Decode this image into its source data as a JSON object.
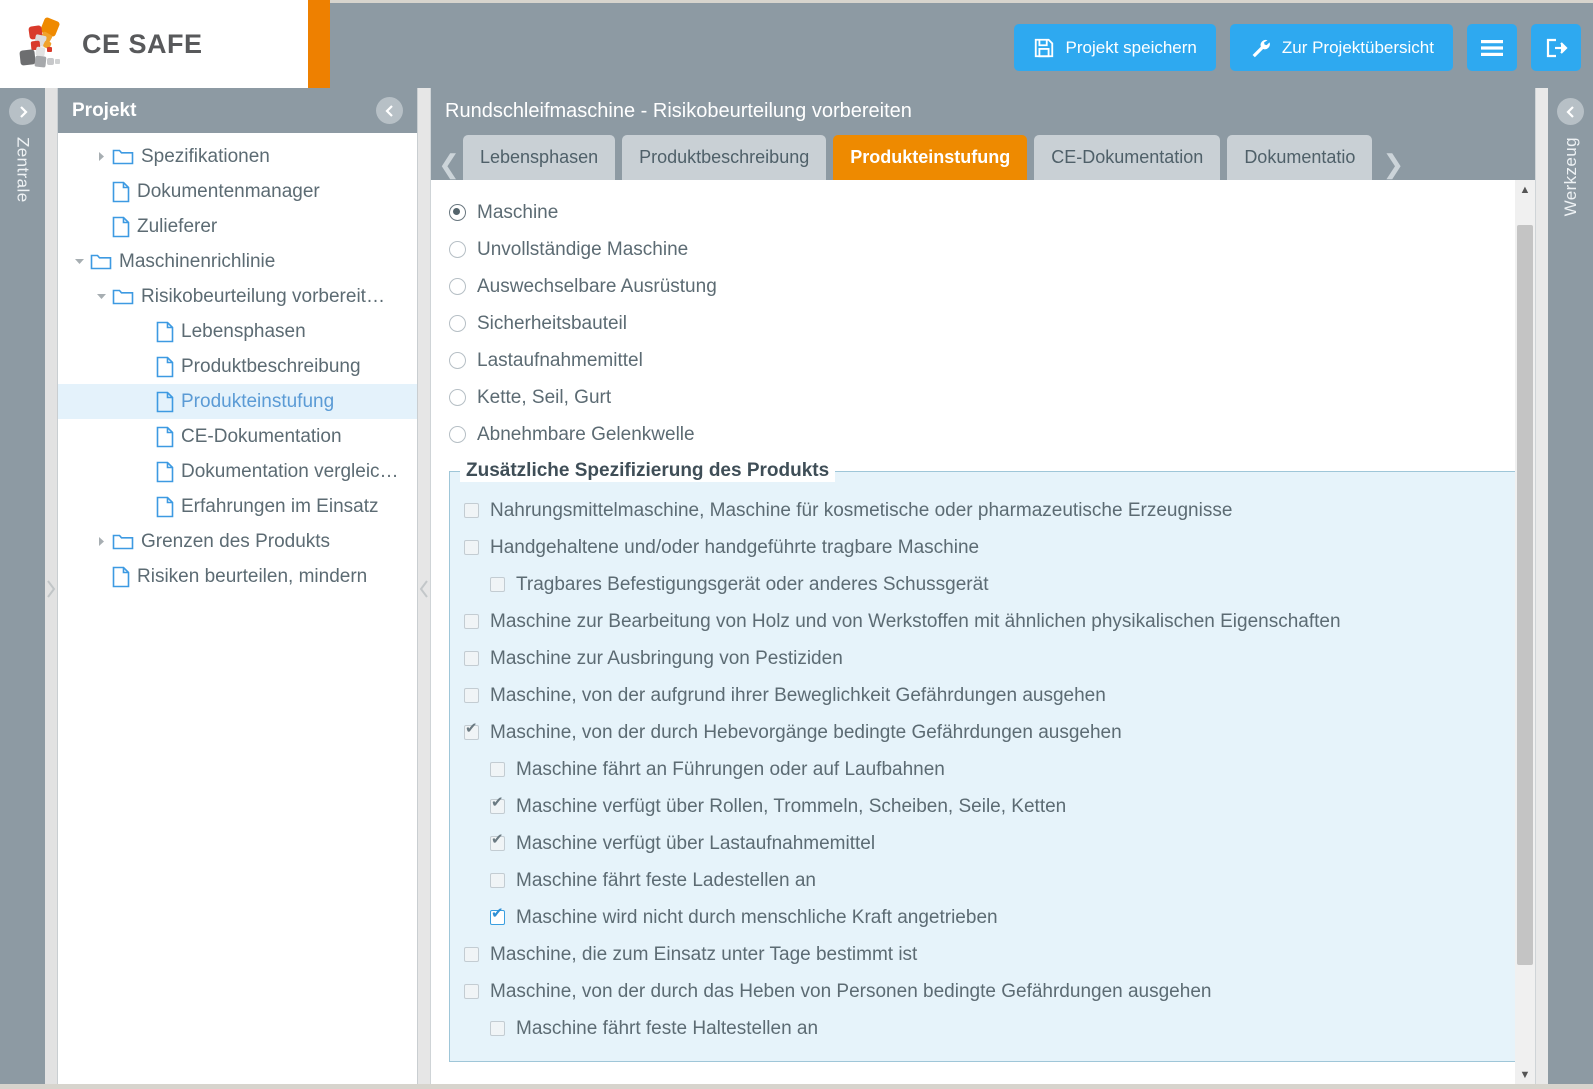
{
  "app": {
    "brand": "CE SAFE",
    "accent_orange": "#ee8000",
    "accent_blue": "#2ea9f0",
    "header_gray": "#8d9aa3"
  },
  "toolbar": {
    "save_label": "Projekt speichern",
    "overview_label": "Zur Projektübersicht",
    "menu_icon": "hamburger-icon",
    "logout_icon": "logout-icon",
    "save_icon": "floppy-disk-icon",
    "overview_icon": "wrench-icon"
  },
  "rails": {
    "left_label": "Zentrale",
    "right_label": "Werkzeug"
  },
  "tree": {
    "title": "Projekt",
    "collapse_icon": "chevron-left-circle-icon",
    "items": [
      {
        "label": "Spezifikationen",
        "icon": "folder-icon",
        "indent": 1,
        "twist": "right",
        "selected": false
      },
      {
        "label": "Dokumentenmanager",
        "icon": "document-icon",
        "indent": 1,
        "twist": "none",
        "selected": false
      },
      {
        "label": "Zulieferer",
        "icon": "document-icon",
        "indent": 1,
        "twist": "none",
        "selected": false
      },
      {
        "label": "Maschinenrichlinie",
        "icon": "folder-icon",
        "indent": 0,
        "twist": "down",
        "selected": false
      },
      {
        "label": "Risikobeurteilung vorbereit…",
        "icon": "folder-icon",
        "indent": 1,
        "twist": "down",
        "selected": false
      },
      {
        "label": "Lebensphasen",
        "icon": "document-icon",
        "indent": 3,
        "twist": "none",
        "selected": false
      },
      {
        "label": "Produktbeschreibung",
        "icon": "document-icon",
        "indent": 3,
        "twist": "none",
        "selected": false
      },
      {
        "label": "Produkteinstufung",
        "icon": "document-icon",
        "indent": 3,
        "twist": "none",
        "selected": true
      },
      {
        "label": "CE-Dokumentation",
        "icon": "document-icon",
        "indent": 3,
        "twist": "none",
        "selected": false
      },
      {
        "label": "Dokumentation vergleic…",
        "icon": "document-icon",
        "indent": 3,
        "twist": "none",
        "selected": false
      },
      {
        "label": "Erfahrungen im Einsatz",
        "icon": "document-icon",
        "indent": 3,
        "twist": "none",
        "selected": false
      },
      {
        "label": "Grenzen des Produkts",
        "icon": "folder-icon",
        "indent": 1,
        "twist": "right",
        "selected": false
      },
      {
        "label": "Risiken beurteilen, mindern",
        "icon": "document-icon",
        "indent": 1,
        "twist": "none",
        "selected": false
      }
    ]
  },
  "main": {
    "title": "Rundschleifmaschine - Risikobeurteilung vorbereiten",
    "tab_prev_icon": "chevron-left-icon",
    "tab_next_icon": "chevron-right-icon",
    "tabs": [
      {
        "label": "Lebensphasen",
        "active": false
      },
      {
        "label": "Produktbeschreibung",
        "active": false
      },
      {
        "label": "Produkteinstufung",
        "active": true
      },
      {
        "label": "CE-Dokumentation",
        "active": false
      },
      {
        "label": "Dokumentatio",
        "active": false
      }
    ]
  },
  "classification": {
    "options": [
      {
        "label": "Maschine",
        "selected": true
      },
      {
        "label": "Unvollständige Maschine",
        "selected": false
      },
      {
        "label": "Auswechselbare Ausrüstung",
        "selected": false
      },
      {
        "label": "Sicherheitsbauteil",
        "selected": false
      },
      {
        "label": "Lastaufnahmemittel",
        "selected": false
      },
      {
        "label": "Kette, Seil, Gurt",
        "selected": false
      },
      {
        "label": "Abnehmbare Gelenkwelle",
        "selected": false
      }
    ]
  },
  "specification": {
    "legend": "Zusätzliche Spezifizierung des Produkts",
    "items": [
      {
        "label": "Nahrungsmittelmaschine, Maschine für kosmetische oder pharmazeutische Erzeugnisse",
        "checked": false,
        "indent": 0,
        "focused": false
      },
      {
        "label": "Handgehaltene und/oder handgeführte tragbare Maschine",
        "checked": false,
        "indent": 0,
        "focused": false
      },
      {
        "label": "Tragbares Befestigungsgerät oder anderes Schussgerät",
        "checked": false,
        "indent": 1,
        "focused": false
      },
      {
        "label": "Maschine zur Bearbeitung von Holz und von Werkstoffen mit ähnlichen physikalischen Eigenschaften",
        "checked": false,
        "indent": 0,
        "focused": false
      },
      {
        "label": "Maschine zur Ausbringung von Pestiziden",
        "checked": false,
        "indent": 0,
        "focused": false
      },
      {
        "label": "Maschine, von der aufgrund ihrer Beweglichkeit Gefährdungen ausgehen",
        "checked": false,
        "indent": 0,
        "focused": false
      },
      {
        "label": "Maschine, von der durch Hebevorgänge bedingte Gefährdungen ausgehen",
        "checked": true,
        "indent": 0,
        "focused": false
      },
      {
        "label": "Maschine fährt an Führungen oder auf Laufbahnen",
        "checked": false,
        "indent": 1,
        "focused": false
      },
      {
        "label": "Maschine verfügt über Rollen, Trommeln, Scheiben, Seile, Ketten",
        "checked": true,
        "indent": 1,
        "focused": false
      },
      {
        "label": "Maschine verfügt über Lastaufnahmemittel",
        "checked": true,
        "indent": 1,
        "focused": false
      },
      {
        "label": "Maschine fährt feste Ladestellen an",
        "checked": false,
        "indent": 1,
        "focused": false
      },
      {
        "label": "Maschine wird nicht durch menschliche Kraft angetrieben",
        "checked": true,
        "indent": 1,
        "focused": true
      },
      {
        "label": "Maschine, die zum Einsatz unter Tage bestimmt ist",
        "checked": false,
        "indent": 0,
        "focused": false
      },
      {
        "label": "Maschine, von der durch das Heben von Personen bedingte Gefährdungen ausgehen",
        "checked": false,
        "indent": 0,
        "focused": false
      },
      {
        "label": "Maschine fährt feste Haltestellen an",
        "checked": false,
        "indent": 1,
        "focused": false
      }
    ]
  },
  "scrollbar": {
    "up_icon": "triangle-up-icon",
    "down_icon": "triangle-down-icon"
  }
}
